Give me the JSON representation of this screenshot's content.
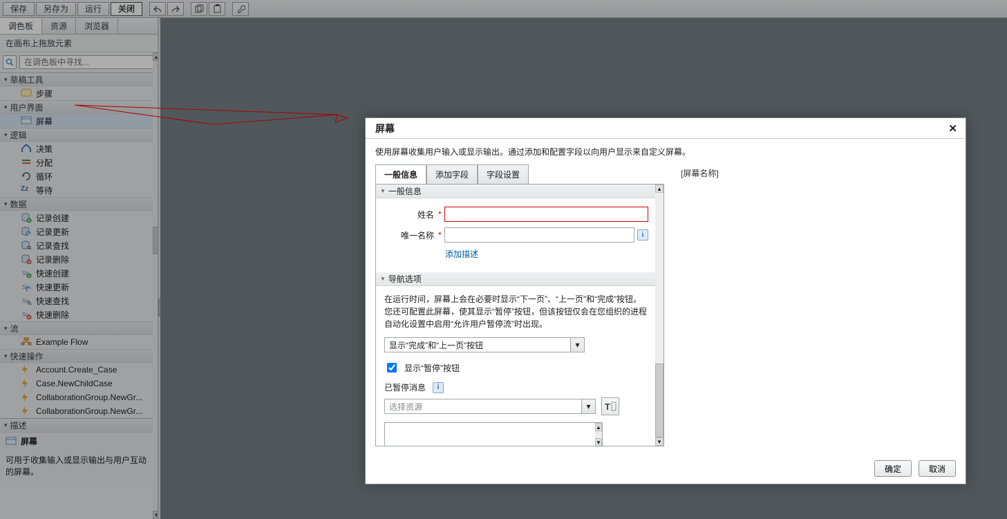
{
  "toolbar": {
    "save": "保存",
    "save_as": "另存为",
    "run": "运行",
    "close": "关闭"
  },
  "sidebar": {
    "tabs": [
      "调色板",
      "资源",
      "浏览器"
    ],
    "canvas_hint": "在画布上拖放元素",
    "search_ph": "在调色板中寻找...",
    "groups": {
      "sketch": "草稿工具",
      "ui": "用户界面",
      "logic": "逻辑",
      "data": "数据",
      "flow": "流",
      "quick": "快速操作"
    },
    "items": {
      "step": "步骤",
      "screen": "屏幕",
      "decision": "决策",
      "assign": "分配",
      "loop": "循环",
      "wait": "等待",
      "rec_create": "记录创建",
      "rec_update": "记录更新",
      "rec_lookup": "记录查找",
      "rec_delete": "记录删除",
      "fast_create": "快速创建",
      "fast_update": "快速更新",
      "fast_lookup": "快速查找",
      "fast_delete": "快速删除",
      "ex_flow": "Example Flow",
      "q1": "Account.Create_Case",
      "q2": "Case.NewChildCase",
      "q3": "CollaborationGroup.NewGr...",
      "q4": "CollaborationGroup.NewGr..."
    },
    "desc_head": "描述",
    "desc_title": "屏幕",
    "desc_text": "可用于收集输入或显示输出与用户互动的屏幕。"
  },
  "dialog": {
    "title": "屏幕",
    "subtitle": "使用屏幕收集用户输入或显示输出。通过添加和配置字段以向用户显示来自定义屏幕。",
    "tabs": [
      "一般信息",
      "添加字段",
      "字段设置"
    ],
    "section_general": "一般信息",
    "label_name": "姓名",
    "label_unique": "唯一名称",
    "add_desc": "添加描述",
    "section_nav": "导航选项",
    "nav_text": "在运行时间，屏幕上会在必要时显示“下一页”、“上一页”和“完成”按钮。您还可配置此屏幕，使其显示“暂停”按钮，但该按钮仅会在您组织的进程自动化设置中启用“允许用户暂停流”时出现。",
    "nav_combo": "显示“完成”和“上一页”按钮",
    "pause_chk": "显示“暂停”按钮",
    "paused_msg": "已暂停消息",
    "resource_ph": "选择资源",
    "preview": "[屏幕名称]",
    "ok": "确定",
    "cancel": "取消"
  }
}
